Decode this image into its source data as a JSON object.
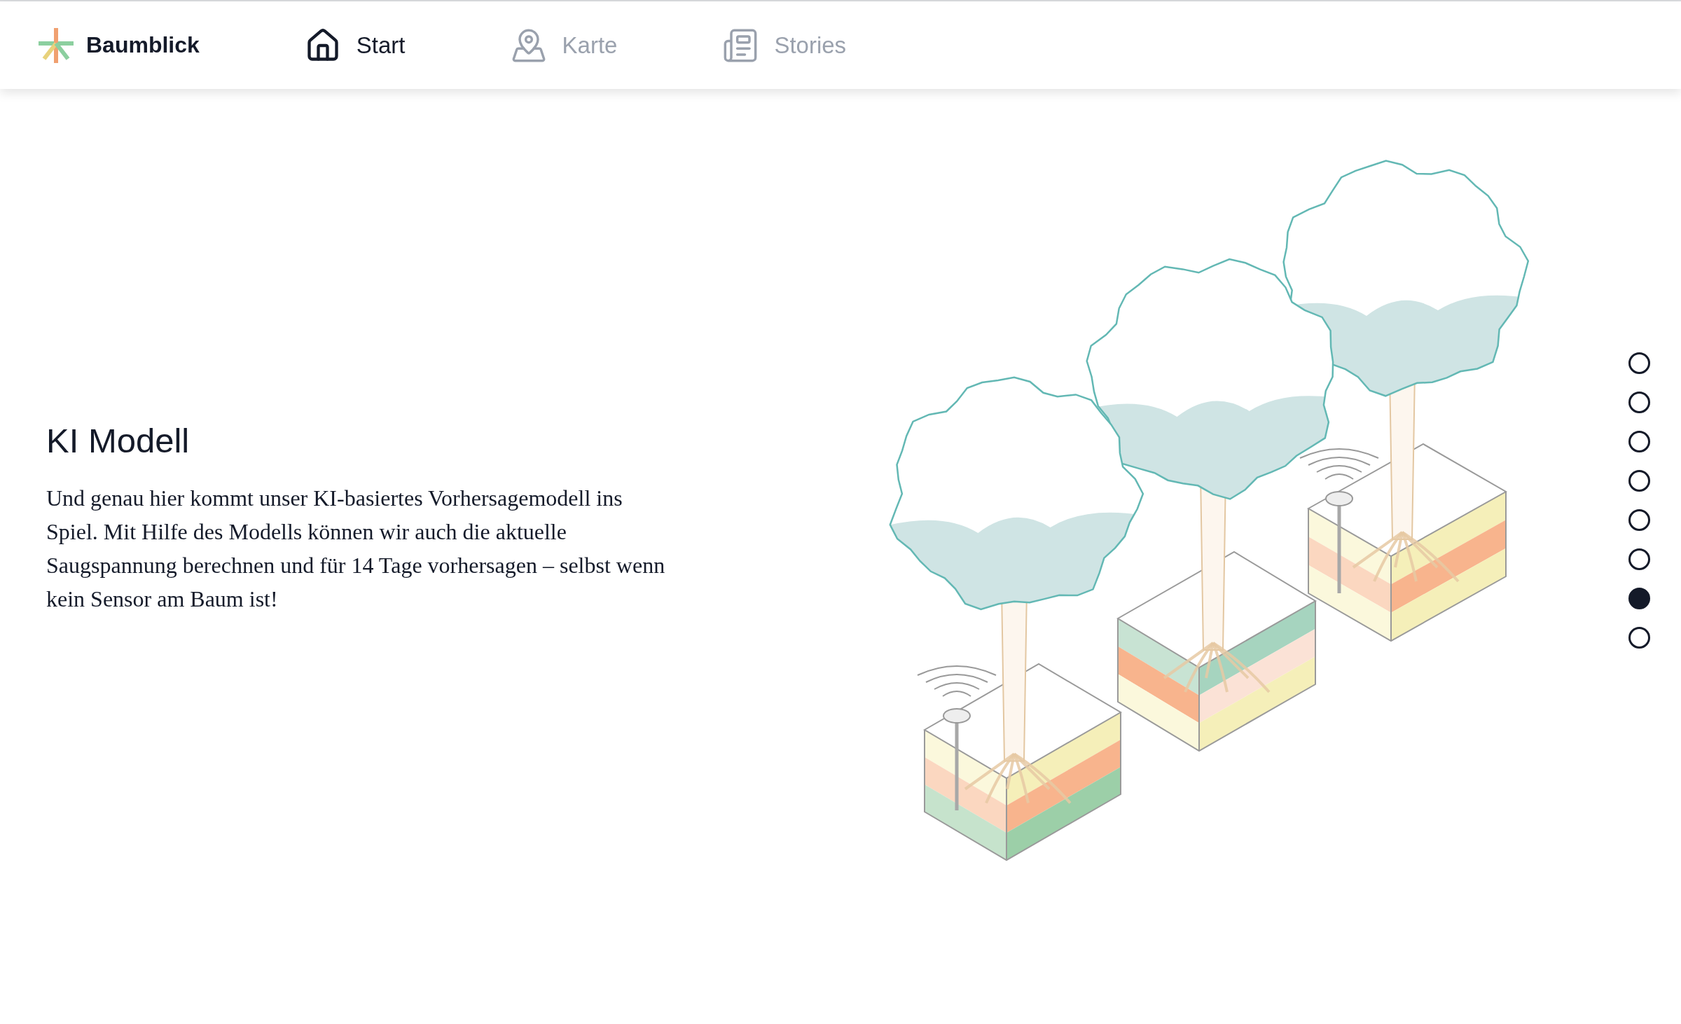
{
  "brand": {
    "name": "Baumblick"
  },
  "nav": [
    {
      "label": "Start",
      "kind": "home",
      "selected": true
    },
    {
      "label": "Karte",
      "kind": "map",
      "selected": false
    },
    {
      "label": "Stories",
      "kind": "stories",
      "selected": false
    }
  ],
  "section": {
    "title": "KI Modell",
    "text": "Und genau hier kommt unser KI-basiertes Vorhersagemodell ins Spiel. Mit Hilfe des Modells können wir auch die aktuelle Saugspannung berechnen und für 14 Tage vorhersagen – selbst wenn kein Sensor am Baum ist!"
  },
  "pager": [
    {
      "selected": false
    },
    {
      "selected": false
    },
    {
      "selected": false
    },
    {
      "selected": false
    },
    {
      "selected": false
    },
    {
      "selected": false
    },
    {
      "selected": true
    },
    {
      "selected": false
    }
  ]
}
